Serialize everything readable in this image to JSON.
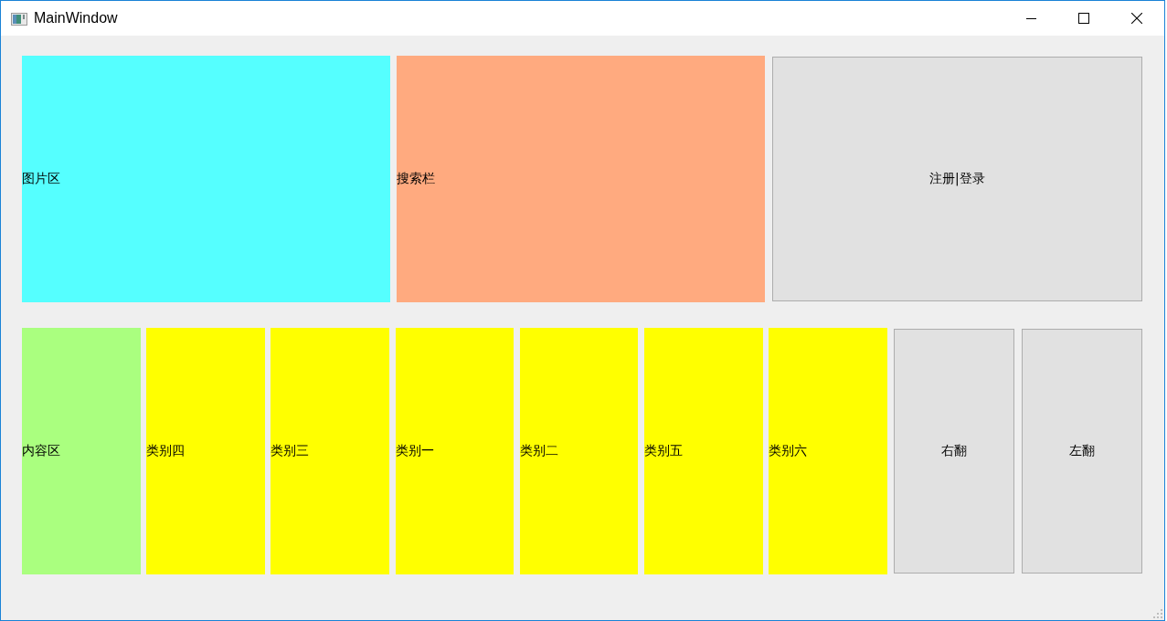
{
  "window": {
    "title": "MainWindow"
  },
  "top_row": [
    {
      "kind": "label",
      "text": "图片区",
      "color": "#55ffff"
    },
    {
      "kind": "label",
      "text": "搜索栏",
      "color": "#ffaa7f"
    },
    {
      "kind": "button",
      "text": "注册|登录"
    }
  ],
  "bottom_row": [
    {
      "kind": "label",
      "text": "内容区",
      "color": "#aaff7f"
    },
    {
      "kind": "label",
      "text": "类别四",
      "color": "#ffff00"
    },
    {
      "kind": "label",
      "text": "类别三",
      "color": "#ffff00"
    },
    {
      "kind": "label",
      "text": "类别一",
      "color": "#ffff00"
    },
    {
      "kind": "label",
      "text": "类别二",
      "color": "#ffff00"
    },
    {
      "kind": "label",
      "text": "类别五",
      "color": "#ffff00"
    },
    {
      "kind": "label",
      "text": "类别六",
      "color": "#ffff00"
    },
    {
      "kind": "button",
      "text": "右翻"
    },
    {
      "kind": "button",
      "text": "左翻"
    }
  ]
}
